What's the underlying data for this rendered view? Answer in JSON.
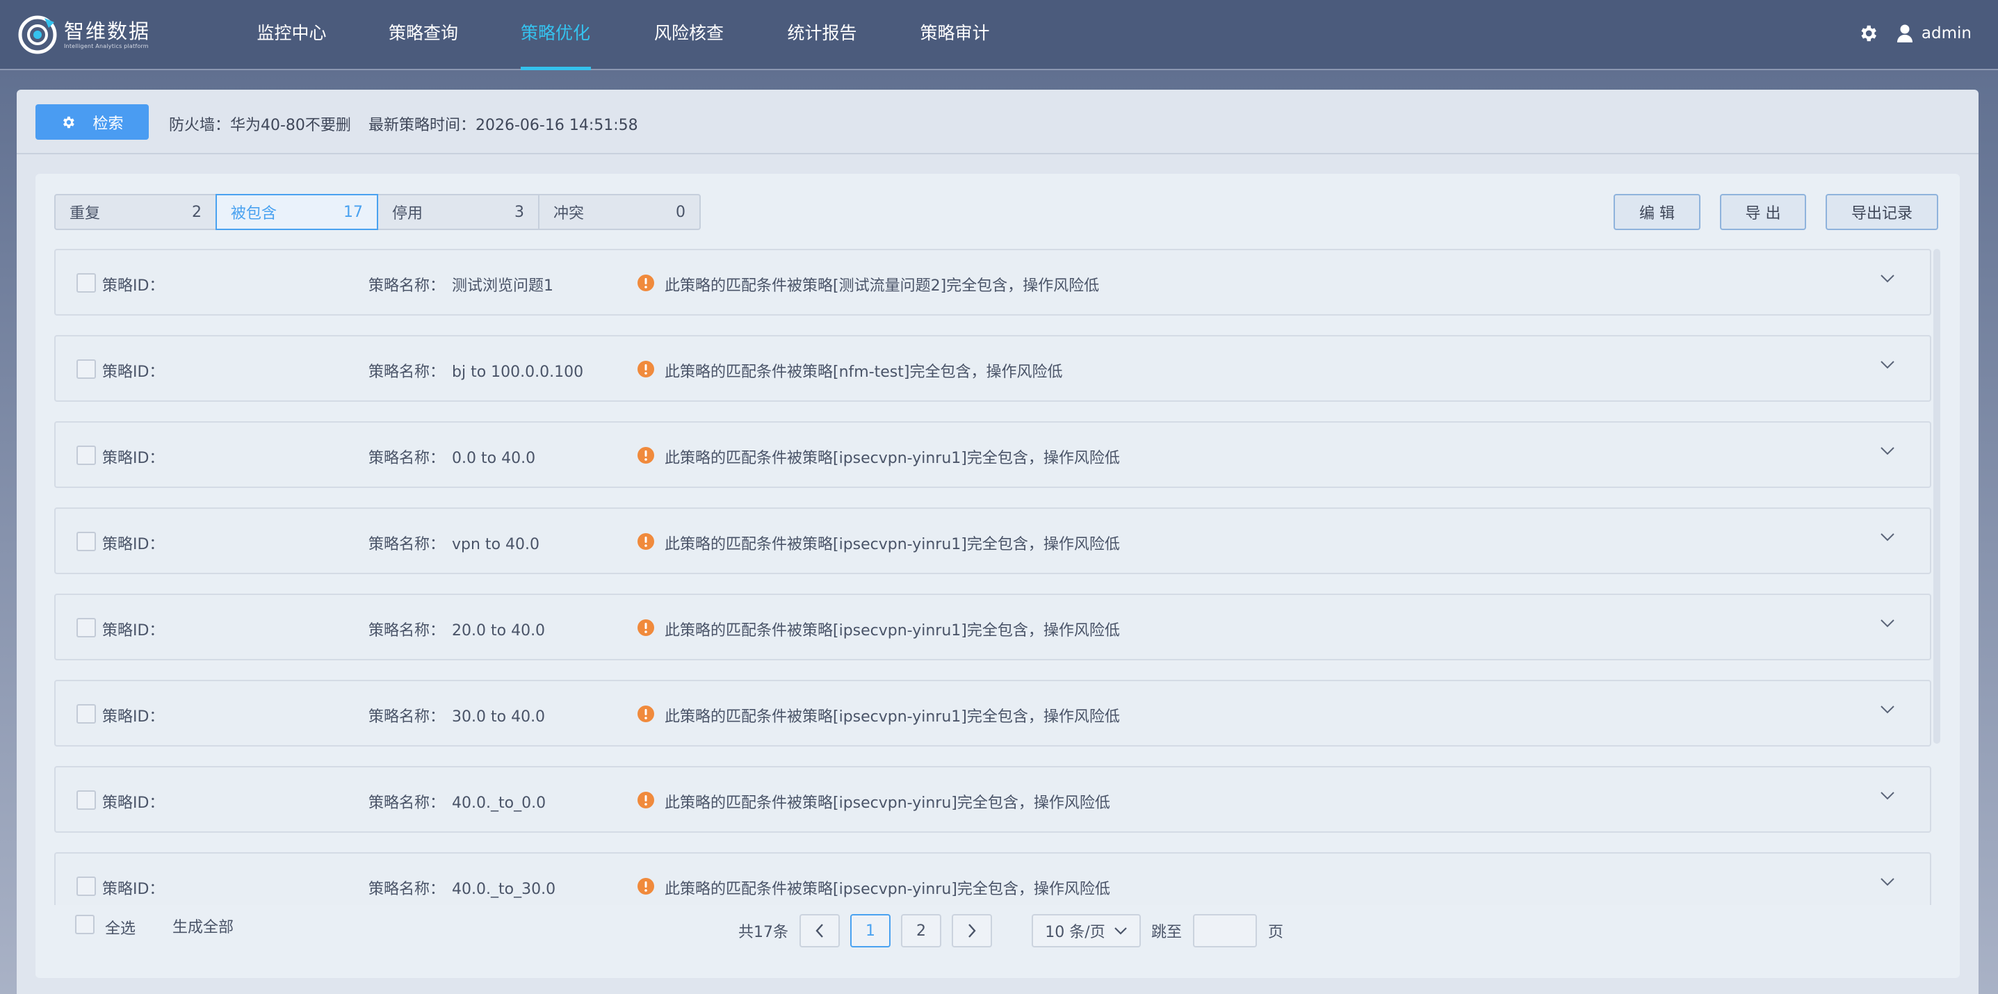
{
  "app": {
    "logo_cn": "智维数据",
    "logo_en": "Intelligent Analytics platform"
  },
  "nav": {
    "items": [
      {
        "label": "监控中心"
      },
      {
        "label": "策略查询"
      },
      {
        "label": "策略优化",
        "active": true
      },
      {
        "label": "风险核查"
      },
      {
        "label": "统计报告"
      },
      {
        "label": "策略审计"
      }
    ]
  },
  "header": {
    "settings_icon": "gear-icon",
    "user_icon": "user-icon",
    "username": "admin"
  },
  "toolbar": {
    "search_label": "检索",
    "firewall": "防火墙：华为40-80不要删",
    "latest_time": "最新策略时间：2026-06-16 14:51:58"
  },
  "tabs": [
    {
      "label": "重复",
      "count": "2"
    },
    {
      "label": "被包含",
      "count": "17",
      "active": true
    },
    {
      "label": "停用",
      "count": "3"
    },
    {
      "label": "冲突",
      "count": "0"
    }
  ],
  "actions": {
    "edit": "编 辑",
    "export": "导 出",
    "export_log": "导出记录"
  },
  "list_labels": {
    "id_label": "策略ID：",
    "name_label": "策略名称："
  },
  "rows": [
    {
      "name": "测试浏览问题1",
      "message": "此策略的匹配条件被策略[测试流量问题2]完全包含，操作风险低"
    },
    {
      "name": "bj to 100.0.0.100",
      "message": "此策略的匹配条件被策略[nfm-test]完全包含，操作风险低"
    },
    {
      "name": "0.0 to 40.0",
      "message": "此策略的匹配条件被策略[ipsecvpn-yinru1]完全包含，操作风险低"
    },
    {
      "name": "vpn to 40.0",
      "message": "此策略的匹配条件被策略[ipsecvpn-yinru1]完全包含，操作风险低"
    },
    {
      "name": "20.0 to 40.0",
      "message": "此策略的匹配条件被策略[ipsecvpn-yinru1]完全包含，操作风险低"
    },
    {
      "name": "30.0 to 40.0",
      "message": "此策略的匹配条件被策略[ipsecvpn-yinru1]完全包含，操作风险低"
    },
    {
      "name": "40.0._to_0.0",
      "message": "此策略的匹配条件被策略[ipsecvpn-yinru]完全包含，操作风险低"
    },
    {
      "name": "40.0._to_30.0",
      "message": "此策略的匹配条件被策略[ipsecvpn-yinru]完全包含，操作风险低"
    }
  ],
  "footer": {
    "select_all": "全选",
    "generate_all": "生成全部"
  },
  "pagination": {
    "total": "共17条",
    "pages": [
      "1",
      "2"
    ],
    "current": "1",
    "page_size": "10 条/页",
    "jump_label": "跳至",
    "jump_value": "",
    "page_suffix": "页"
  },
  "colors": {
    "accent": "#4a9cf2",
    "nav_active": "#35c2ee",
    "warning": "#f08a3c",
    "header_bg": "#4b5b7c"
  }
}
